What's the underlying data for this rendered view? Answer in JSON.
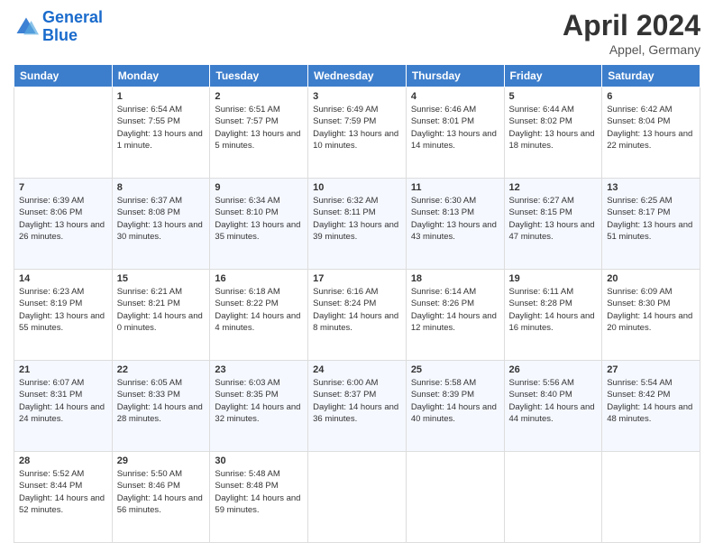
{
  "header": {
    "logo_line1": "General",
    "logo_line2": "Blue",
    "title": "April 2024",
    "subtitle": "Appel, Germany"
  },
  "days_of_week": [
    "Sunday",
    "Monday",
    "Tuesday",
    "Wednesday",
    "Thursday",
    "Friday",
    "Saturday"
  ],
  "weeks": [
    [
      {
        "day": "",
        "sunrise": "",
        "sunset": "",
        "daylight": ""
      },
      {
        "day": "1",
        "sunrise": "Sunrise: 6:54 AM",
        "sunset": "Sunset: 7:55 PM",
        "daylight": "Daylight: 13 hours and 1 minute."
      },
      {
        "day": "2",
        "sunrise": "Sunrise: 6:51 AM",
        "sunset": "Sunset: 7:57 PM",
        "daylight": "Daylight: 13 hours and 5 minutes."
      },
      {
        "day": "3",
        "sunrise": "Sunrise: 6:49 AM",
        "sunset": "Sunset: 7:59 PM",
        "daylight": "Daylight: 13 hours and 10 minutes."
      },
      {
        "day": "4",
        "sunrise": "Sunrise: 6:46 AM",
        "sunset": "Sunset: 8:01 PM",
        "daylight": "Daylight: 13 hours and 14 minutes."
      },
      {
        "day": "5",
        "sunrise": "Sunrise: 6:44 AM",
        "sunset": "Sunset: 8:02 PM",
        "daylight": "Daylight: 13 hours and 18 minutes."
      },
      {
        "day": "6",
        "sunrise": "Sunrise: 6:42 AM",
        "sunset": "Sunset: 8:04 PM",
        "daylight": "Daylight: 13 hours and 22 minutes."
      }
    ],
    [
      {
        "day": "7",
        "sunrise": "Sunrise: 6:39 AM",
        "sunset": "Sunset: 8:06 PM",
        "daylight": "Daylight: 13 hours and 26 minutes."
      },
      {
        "day": "8",
        "sunrise": "Sunrise: 6:37 AM",
        "sunset": "Sunset: 8:08 PM",
        "daylight": "Daylight: 13 hours and 30 minutes."
      },
      {
        "day": "9",
        "sunrise": "Sunrise: 6:34 AM",
        "sunset": "Sunset: 8:10 PM",
        "daylight": "Daylight: 13 hours and 35 minutes."
      },
      {
        "day": "10",
        "sunrise": "Sunrise: 6:32 AM",
        "sunset": "Sunset: 8:11 PM",
        "daylight": "Daylight: 13 hours and 39 minutes."
      },
      {
        "day": "11",
        "sunrise": "Sunrise: 6:30 AM",
        "sunset": "Sunset: 8:13 PM",
        "daylight": "Daylight: 13 hours and 43 minutes."
      },
      {
        "day": "12",
        "sunrise": "Sunrise: 6:27 AM",
        "sunset": "Sunset: 8:15 PM",
        "daylight": "Daylight: 13 hours and 47 minutes."
      },
      {
        "day": "13",
        "sunrise": "Sunrise: 6:25 AM",
        "sunset": "Sunset: 8:17 PM",
        "daylight": "Daylight: 13 hours and 51 minutes."
      }
    ],
    [
      {
        "day": "14",
        "sunrise": "Sunrise: 6:23 AM",
        "sunset": "Sunset: 8:19 PM",
        "daylight": "Daylight: 13 hours and 55 minutes."
      },
      {
        "day": "15",
        "sunrise": "Sunrise: 6:21 AM",
        "sunset": "Sunset: 8:21 PM",
        "daylight": "Daylight: 14 hours and 0 minutes."
      },
      {
        "day": "16",
        "sunrise": "Sunrise: 6:18 AM",
        "sunset": "Sunset: 8:22 PM",
        "daylight": "Daylight: 14 hours and 4 minutes."
      },
      {
        "day": "17",
        "sunrise": "Sunrise: 6:16 AM",
        "sunset": "Sunset: 8:24 PM",
        "daylight": "Daylight: 14 hours and 8 minutes."
      },
      {
        "day": "18",
        "sunrise": "Sunrise: 6:14 AM",
        "sunset": "Sunset: 8:26 PM",
        "daylight": "Daylight: 14 hours and 12 minutes."
      },
      {
        "day": "19",
        "sunrise": "Sunrise: 6:11 AM",
        "sunset": "Sunset: 8:28 PM",
        "daylight": "Daylight: 14 hours and 16 minutes."
      },
      {
        "day": "20",
        "sunrise": "Sunrise: 6:09 AM",
        "sunset": "Sunset: 8:30 PM",
        "daylight": "Daylight: 14 hours and 20 minutes."
      }
    ],
    [
      {
        "day": "21",
        "sunrise": "Sunrise: 6:07 AM",
        "sunset": "Sunset: 8:31 PM",
        "daylight": "Daylight: 14 hours and 24 minutes."
      },
      {
        "day": "22",
        "sunrise": "Sunrise: 6:05 AM",
        "sunset": "Sunset: 8:33 PM",
        "daylight": "Daylight: 14 hours and 28 minutes."
      },
      {
        "day": "23",
        "sunrise": "Sunrise: 6:03 AM",
        "sunset": "Sunset: 8:35 PM",
        "daylight": "Daylight: 14 hours and 32 minutes."
      },
      {
        "day": "24",
        "sunrise": "Sunrise: 6:00 AM",
        "sunset": "Sunset: 8:37 PM",
        "daylight": "Daylight: 14 hours and 36 minutes."
      },
      {
        "day": "25",
        "sunrise": "Sunrise: 5:58 AM",
        "sunset": "Sunset: 8:39 PM",
        "daylight": "Daylight: 14 hours and 40 minutes."
      },
      {
        "day": "26",
        "sunrise": "Sunrise: 5:56 AM",
        "sunset": "Sunset: 8:40 PM",
        "daylight": "Daylight: 14 hours and 44 minutes."
      },
      {
        "day": "27",
        "sunrise": "Sunrise: 5:54 AM",
        "sunset": "Sunset: 8:42 PM",
        "daylight": "Daylight: 14 hours and 48 minutes."
      }
    ],
    [
      {
        "day": "28",
        "sunrise": "Sunrise: 5:52 AM",
        "sunset": "Sunset: 8:44 PM",
        "daylight": "Daylight: 14 hours and 52 minutes."
      },
      {
        "day": "29",
        "sunrise": "Sunrise: 5:50 AM",
        "sunset": "Sunset: 8:46 PM",
        "daylight": "Daylight: 14 hours and 56 minutes."
      },
      {
        "day": "30",
        "sunrise": "Sunrise: 5:48 AM",
        "sunset": "Sunset: 8:48 PM",
        "daylight": "Daylight: 14 hours and 59 minutes."
      },
      {
        "day": "",
        "sunrise": "",
        "sunset": "",
        "daylight": ""
      },
      {
        "day": "",
        "sunrise": "",
        "sunset": "",
        "daylight": ""
      },
      {
        "day": "",
        "sunrise": "",
        "sunset": "",
        "daylight": ""
      },
      {
        "day": "",
        "sunrise": "",
        "sunset": "",
        "daylight": ""
      }
    ]
  ]
}
